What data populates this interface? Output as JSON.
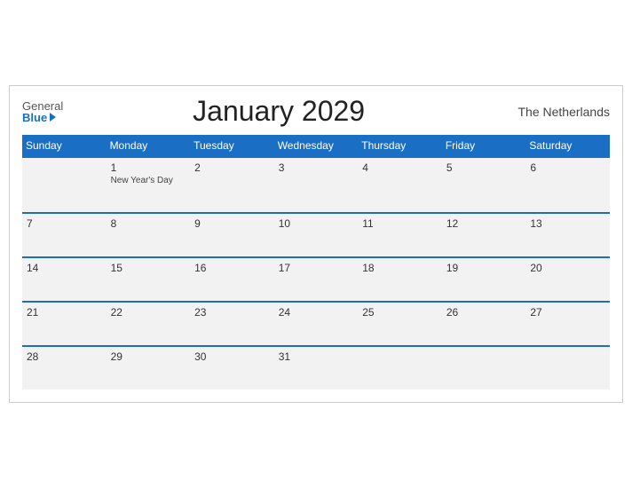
{
  "header": {
    "logo_general": "General",
    "logo_blue": "Blue",
    "title": "January 2029",
    "country": "The Netherlands"
  },
  "weekdays": [
    "Sunday",
    "Monday",
    "Tuesday",
    "Wednesday",
    "Thursday",
    "Friday",
    "Saturday"
  ],
  "weeks": [
    [
      {
        "day": "",
        "event": ""
      },
      {
        "day": "1",
        "event": "New Year's Day"
      },
      {
        "day": "2",
        "event": ""
      },
      {
        "day": "3",
        "event": ""
      },
      {
        "day": "4",
        "event": ""
      },
      {
        "day": "5",
        "event": ""
      },
      {
        "day": "6",
        "event": ""
      }
    ],
    [
      {
        "day": "7",
        "event": ""
      },
      {
        "day": "8",
        "event": ""
      },
      {
        "day": "9",
        "event": ""
      },
      {
        "day": "10",
        "event": ""
      },
      {
        "day": "11",
        "event": ""
      },
      {
        "day": "12",
        "event": ""
      },
      {
        "day": "13",
        "event": ""
      }
    ],
    [
      {
        "day": "14",
        "event": ""
      },
      {
        "day": "15",
        "event": ""
      },
      {
        "day": "16",
        "event": ""
      },
      {
        "day": "17",
        "event": ""
      },
      {
        "day": "18",
        "event": ""
      },
      {
        "day": "19",
        "event": ""
      },
      {
        "day": "20",
        "event": ""
      }
    ],
    [
      {
        "day": "21",
        "event": ""
      },
      {
        "day": "22",
        "event": ""
      },
      {
        "day": "23",
        "event": ""
      },
      {
        "day": "24",
        "event": ""
      },
      {
        "day": "25",
        "event": ""
      },
      {
        "day": "26",
        "event": ""
      },
      {
        "day": "27",
        "event": ""
      }
    ],
    [
      {
        "day": "28",
        "event": ""
      },
      {
        "day": "29",
        "event": ""
      },
      {
        "day": "30",
        "event": ""
      },
      {
        "day": "31",
        "event": ""
      },
      {
        "day": "",
        "event": ""
      },
      {
        "day": "",
        "event": ""
      },
      {
        "day": "",
        "event": ""
      }
    ]
  ]
}
